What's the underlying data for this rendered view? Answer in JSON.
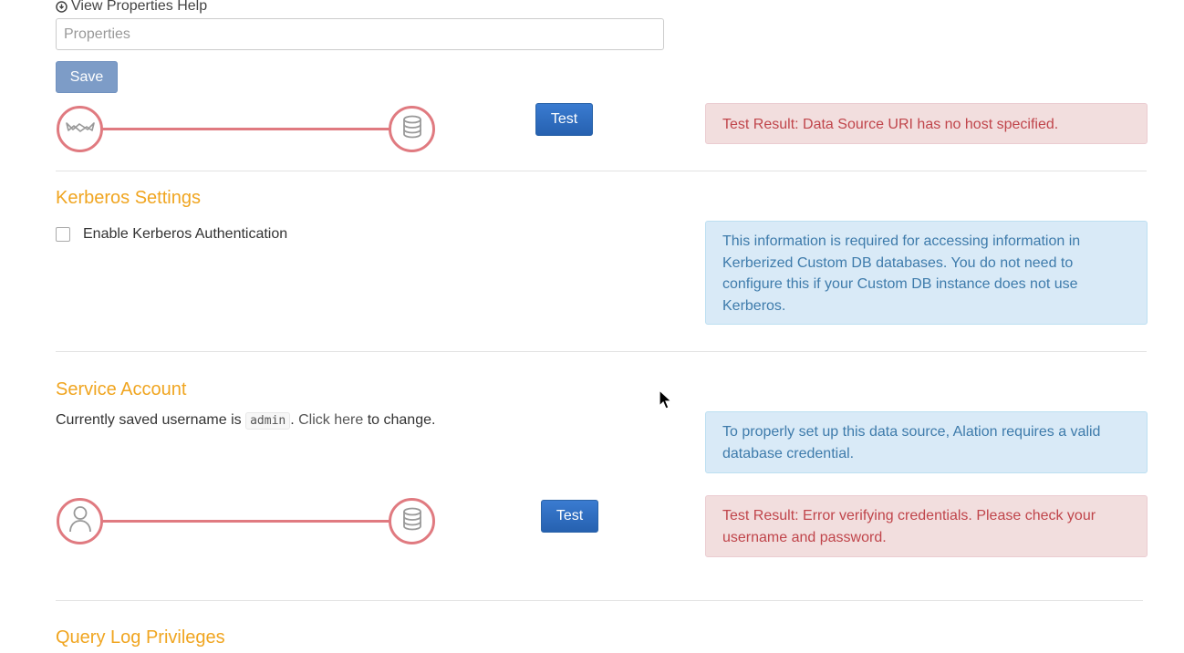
{
  "properties": {
    "help_link": "View Properties Help",
    "placeholder": "Properties",
    "save_label": "Save"
  },
  "connection_test": {
    "test_label": "Test",
    "result": "Test Result: Data Source URI has no host specified."
  },
  "kerberos": {
    "title": "Kerberos Settings",
    "checkbox_label": "Enable Kerberos Authentication",
    "checked": false,
    "info": "This information is required for accessing information in Kerberized Custom DB databases. You do not need to configure this if your Custom DB instance does not use Kerberos."
  },
  "service_account": {
    "title": "Service Account",
    "text_before": "Currently saved username is",
    "username": "admin",
    "text_middle": ". ",
    "link_label": "Click here",
    "text_after": " to change.",
    "info": "To properly set up this data source, Alation requires a valid database credential.",
    "test_label": "Test",
    "result": "Test Result: Error verifying credentials. Please check your username and password."
  },
  "query_log": {
    "title": "Query Log Privileges"
  },
  "colors": {
    "accent": "#f0a520",
    "primary": "#2a63a8",
    "danger_text": "#c0454b",
    "info_text": "#3e7bab",
    "node_border": "#e07a80"
  },
  "icons": [
    "help-circle-icon",
    "datasource-icon",
    "database-icon",
    "user-icon",
    "mouse-cursor-icon"
  ]
}
